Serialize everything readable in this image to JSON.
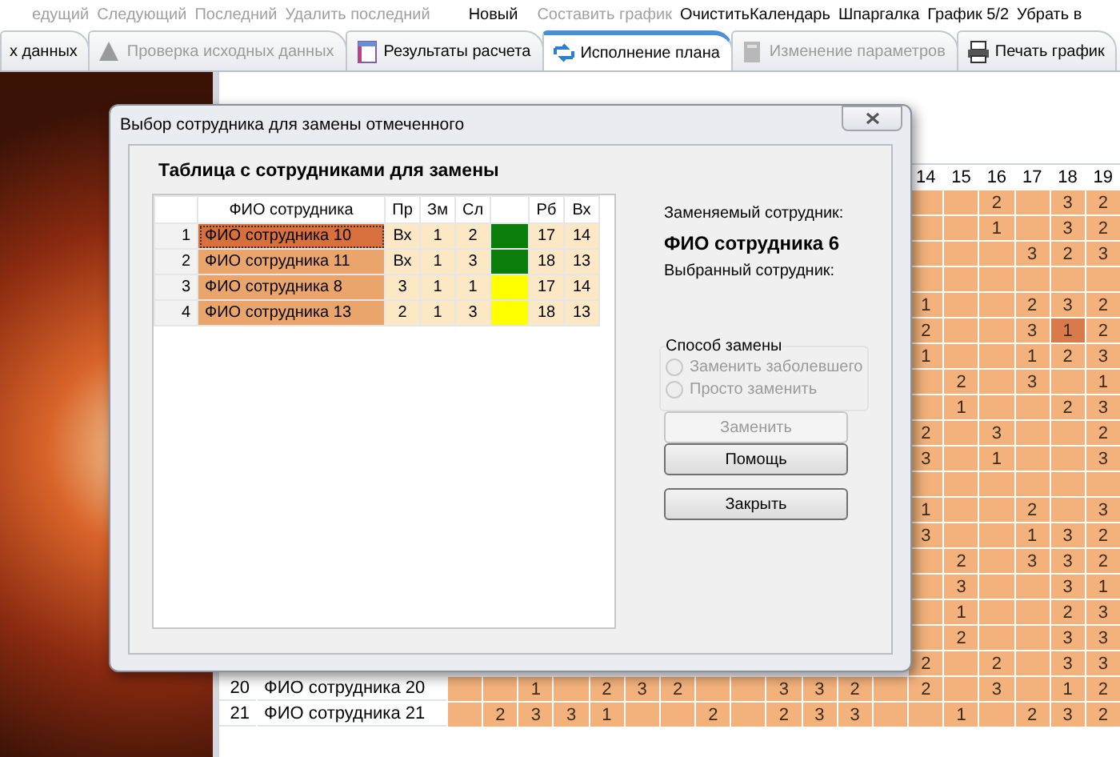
{
  "toolbar": {
    "groups": [
      [
        {
          "label": "едущий",
          "disabled": true
        },
        {
          "label": "Следующий",
          "disabled": true
        },
        {
          "label": "Последний",
          "disabled": true
        },
        {
          "label": "Удалить последний",
          "disabled": true
        }
      ],
      [
        {
          "label": "Новый",
          "disabled": false
        }
      ],
      [
        {
          "label": "Составить график",
          "disabled": true
        },
        {
          "label": "Очистить",
          "disabled": false
        }
      ],
      [
        {
          "label": "Календарь",
          "disabled": false
        },
        {
          "label": "Шпаргалка",
          "disabled": false
        },
        {
          "label": "График 5/2",
          "disabled": false
        },
        {
          "label": "Убрать в",
          "disabled": false
        }
      ]
    ]
  },
  "tabs": [
    {
      "label": "х данных",
      "selected": false,
      "disabled": false
    },
    {
      "label": "Проверка исходных данных",
      "selected": false,
      "disabled": true
    },
    {
      "label": "Результаты расчета",
      "selected": false,
      "disabled": false
    },
    {
      "label": "Исполнение плана",
      "selected": true,
      "disabled": false
    },
    {
      "label": "Изменение параметров",
      "selected": false,
      "disabled": true
    },
    {
      "label": "Печать график",
      "selected": false,
      "disabled": false
    }
  ],
  "schedule": {
    "columns": [
      "14",
      "15",
      "16",
      "17",
      "18",
      "19"
    ],
    "rows": [
      {
        "cells": [
          null,
          null,
          "2",
          null,
          "3",
          "2"
        ]
      },
      {
        "cells": [
          null,
          null,
          "1",
          null,
          "3",
          "2"
        ]
      },
      {
        "cells": [
          null,
          null,
          null,
          "3",
          "2",
          "3"
        ]
      },
      {
        "cells": [
          null,
          null,
          null,
          null,
          null,
          null
        ]
      },
      {
        "cells": [
          "1",
          null,
          null,
          "2",
          "3",
          "2"
        ]
      },
      {
        "cells": [
          "2",
          null,
          null,
          "3",
          {
            "text": "1",
            "selected": true
          },
          "2"
        ]
      },
      {
        "cells": [
          "1",
          null,
          null,
          "1",
          "2",
          "3"
        ]
      },
      {
        "cells": [
          null,
          "2",
          null,
          "3",
          null,
          "1"
        ]
      },
      {
        "cells": [
          null,
          "1",
          null,
          null,
          "2",
          "3"
        ]
      },
      {
        "cells": [
          "2",
          null,
          "3",
          null,
          null,
          "2"
        ]
      },
      {
        "cells": [
          "3",
          null,
          "1",
          null,
          null,
          "3"
        ]
      },
      {
        "cells": [
          null,
          null,
          null,
          null,
          null,
          null
        ]
      },
      {
        "cells": [
          "1",
          null,
          null,
          "2",
          null,
          "3"
        ]
      },
      {
        "cells": [
          "3",
          null,
          null,
          "1",
          "3",
          "2"
        ]
      },
      {
        "cells": [
          null,
          "2",
          null,
          "3",
          "3",
          "2"
        ]
      },
      {
        "cells": [
          null,
          "3",
          null,
          null,
          "3",
          "1"
        ]
      },
      {
        "cells": [
          null,
          "1",
          null,
          null,
          "2",
          "3"
        ]
      },
      {
        "cells": [
          null,
          "2",
          null,
          null,
          "3",
          "3"
        ]
      },
      {
        "cells": [
          "2",
          null,
          "2",
          null,
          "3",
          "3"
        ]
      },
      {
        "number": "20",
        "name": "ФИО сотрудника 20",
        "cells": [
          null,
          null,
          "1",
          null,
          "2",
          "3",
          "2",
          null,
          null,
          "3",
          "3",
          "2",
          null,
          "2",
          null,
          "3",
          null,
          "1",
          "2"
        ]
      },
      {
        "number": "21",
        "name": "ФИО сотрудника 21",
        "cells": [
          null,
          "2",
          "3",
          "3",
          "1",
          null,
          null,
          "2",
          null,
          "2",
          "3",
          "3",
          null,
          null,
          "1",
          null,
          "2",
          "3",
          "2"
        ]
      }
    ]
  },
  "dialog": {
    "title": "Выбор сотрудника для замены отмеченного",
    "heading": "Таблица с сотрудниками для замены",
    "table": {
      "columns": [
        {
          "kind": "text",
          "label": "ФИО сотрудника"
        },
        {
          "kind": "text",
          "label": "Пр"
        },
        {
          "kind": "text",
          "label": "Зм"
        },
        {
          "kind": "text",
          "label": "Сл"
        },
        {
          "kind": "color"
        },
        {
          "kind": "text",
          "label": "Рб"
        },
        {
          "kind": "text",
          "label": "Вх"
        }
      ],
      "rows": [
        {
          "number": "1",
          "name": "ФИО сотрудника 10",
          "pr": "Вх",
          "zm": "1",
          "sl": "2",
          "color": "#0a7d0a",
          "rb": "17",
          "vx": "14",
          "selected": true
        },
        {
          "number": "2",
          "name": "ФИО сотрудника 11",
          "pr": "Вх",
          "zm": "1",
          "sl": "3",
          "color": "#0a7d0a",
          "rb": "18",
          "vx": "13",
          "selected": false
        },
        {
          "number": "3",
          "name": "ФИО сотрудника 8",
          "pr": "3",
          "zm": "1",
          "sl": "1",
          "color": "#ffff00",
          "rb": "17",
          "vx": "14",
          "selected": false
        },
        {
          "number": "4",
          "name": "ФИО сотрудника 13",
          "pr": "2",
          "zm": "1",
          "sl": "3",
          "color": "#ffff00",
          "rb": "18",
          "vx": "13",
          "selected": false
        }
      ]
    },
    "replaced_label": "Заменяемый сотрудник:",
    "replaced_name": "ФИО сотрудника 6",
    "chosen_label": "Выбранный сотрудник:",
    "method": {
      "legend": "Способ замены",
      "options": [
        {
          "label": "Заменить заболевшего",
          "selected": false,
          "disabled": true
        },
        {
          "label": "Просто заменить",
          "selected": false,
          "disabled": true
        }
      ]
    },
    "button_groups": [
      [
        {
          "label": "Заменить",
          "disabled": true
        }
      ],
      [
        {
          "label": "Помощь",
          "disabled": false
        },
        {
          "label": "Закрыть",
          "disabled": false
        }
      ]
    ]
  }
}
